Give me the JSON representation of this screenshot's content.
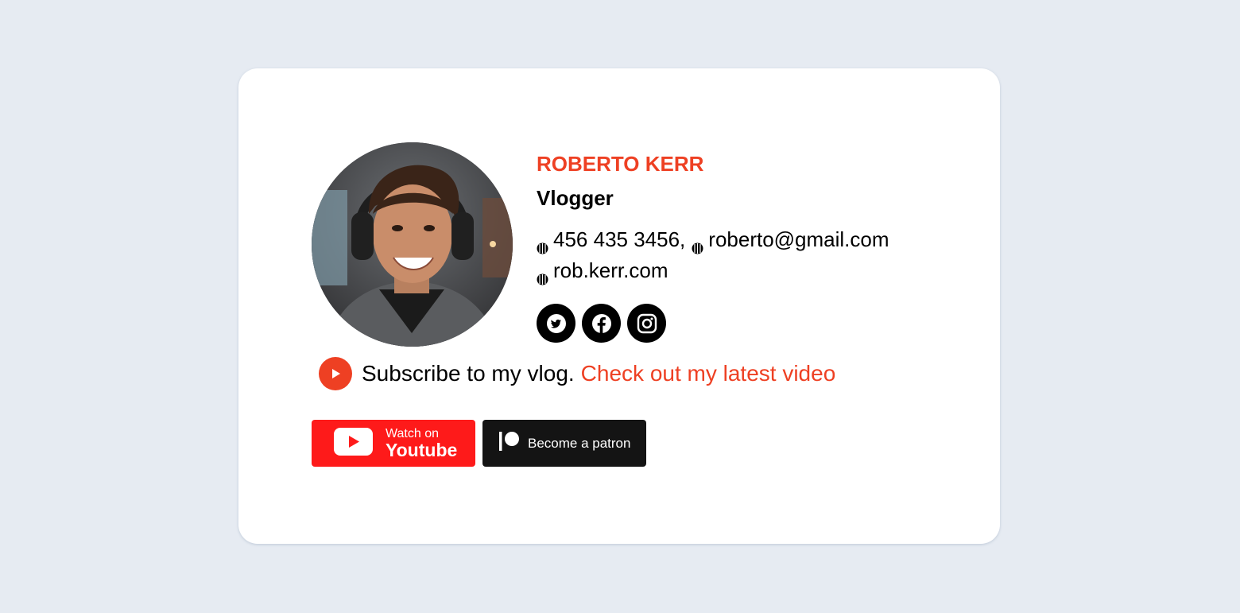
{
  "profile": {
    "name": "ROBERTO KERR",
    "role": "Vlogger",
    "phone": "456 435 3456,",
    "email": "roberto@gmail.com",
    "website": "rob.kerr.com"
  },
  "socials": [
    {
      "icon": "twitter-icon"
    },
    {
      "icon": "facebook-icon"
    },
    {
      "icon": "instagram-icon"
    }
  ],
  "subscribe": {
    "text": "Subscribe to my vlog.",
    "link": "Check out my latest video"
  },
  "buttons": {
    "youtube_small": "Watch on",
    "youtube_big": "Youtube",
    "patreon": "Become a patron"
  },
  "colors": {
    "accent": "#ee4023",
    "youtube": "#fe1a1a",
    "patreon": "#141414",
    "background": "#e6ebf2"
  }
}
